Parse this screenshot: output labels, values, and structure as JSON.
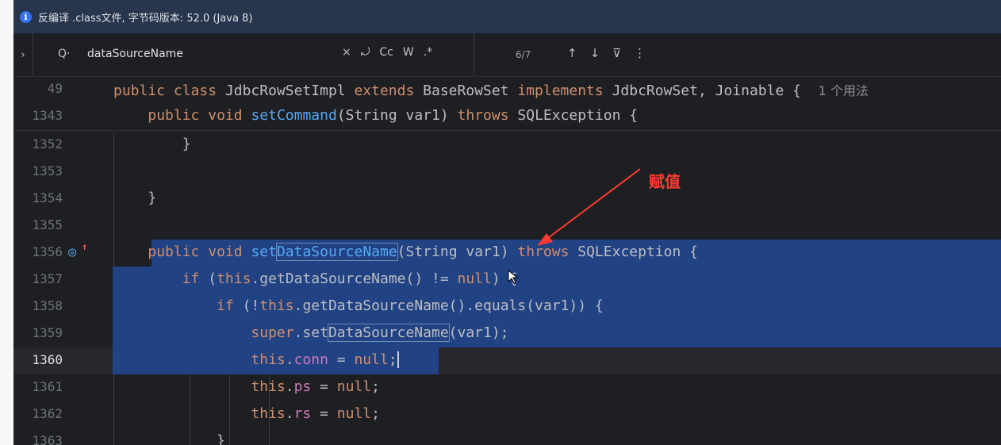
{
  "banner": {
    "icon": "info-icon",
    "text": "反编译 .class文件, 字节码版本: 52.0 (Java 8)"
  },
  "search": {
    "expand_glyph": "›",
    "search_glyph": "Q·",
    "query": "dataSourceName",
    "options": {
      "clear": "×",
      "regex_newline": "⤾",
      "match_case": "Cc",
      "words": "W",
      "regex": ".*"
    },
    "match_count": "6/7",
    "nav": {
      "prev": "↑",
      "next": "↓",
      "filter": "⊽",
      "more": "⋮"
    }
  },
  "editor": {
    "lines": {
      "l49": {
        "num": "49",
        "hint": "1 个用法",
        "t1": "public",
        "t2": " ",
        "t3": "class",
        "t4": " JdbcRowSetImpl ",
        "t5": "extends",
        "t6": " BaseRowSet ",
        "t7": "implements",
        "t8": " JdbcRowSet, Joinable {"
      },
      "l1343": {
        "num": "1343",
        "t1": "public",
        "t2": " ",
        "t3": "void",
        "t4": " ",
        "t5": "setCommand",
        "t6": "(String var1) ",
        "t7": "throws",
        "t8": " SQLException {"
      },
      "l1352": {
        "num": "1352",
        "t1": "}"
      },
      "l1353": {
        "num": "1353"
      },
      "l1354": {
        "num": "1354",
        "t1": "}"
      },
      "l1355": {
        "num": "1355"
      },
      "l1356": {
        "num": "1356",
        "gutter_icon": "override-icon",
        "t1": "public",
        "t2": " ",
        "t3": "void",
        "t4": " ",
        "t5": "set",
        "t6": "DataSourceName",
        "t7": "(String var1) ",
        "t8": "throws",
        "t9": " SQLException {"
      },
      "l1357": {
        "num": "1357",
        "t1": "if",
        "t2": " (",
        "t3": "this",
        "t4": ".getDataSourceName() != ",
        "t5": "null",
        "t6": ") {"
      },
      "l1358": {
        "num": "1358",
        "t1": "if",
        "t2": " (!",
        "t3": "this",
        "t4": ".getDataSourceName().equals(var1)) {"
      },
      "l1359": {
        "num": "1359",
        "t1": "super",
        "t2": ".set",
        "t3": "DataSourceName",
        "t4": "(var1);"
      },
      "l1360": {
        "num": "1360",
        "t1": "this",
        "t2": ".",
        "t3": "conn",
        "t4": " = ",
        "t5": "null",
        "t6": ";"
      },
      "l1361": {
        "num": "1361",
        "t1": "this",
        "t2": ".",
        "t3": "ps",
        "t4": " = ",
        "t5": "null",
        "t6": ";"
      },
      "l1362": {
        "num": "1362",
        "t1": "this",
        "t2": ".",
        "t3": "rs",
        "t4": " = ",
        "t5": "null",
        "t6": ";"
      },
      "l1363": {
        "num": "1363",
        "t1": "}"
      }
    }
  },
  "annotation": {
    "text": "赋值",
    "color": "#ff3b30"
  },
  "colors": {
    "background": "#1e1f22",
    "banner": "#27354d",
    "selection": "#214283",
    "keyword": "#cf8e6d",
    "function": "#56a8f5",
    "field": "#c77dba",
    "text": "#bcbec4",
    "line_number": "#6f737a"
  }
}
